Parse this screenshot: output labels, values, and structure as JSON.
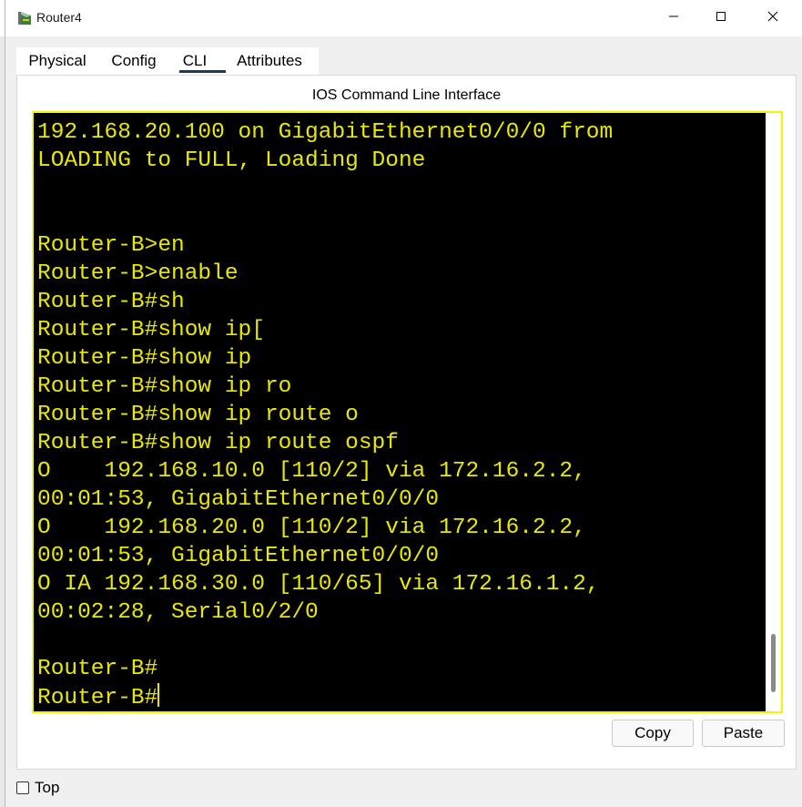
{
  "window": {
    "title": "Router4",
    "icon": "router-icon",
    "controls": [
      "minimize-icon",
      "maximize-icon",
      "close-icon"
    ]
  },
  "tabs": [
    {
      "label": "Physical"
    },
    {
      "label": "Config"
    },
    {
      "label": "CLI",
      "active": true
    },
    {
      "label": "Attributes"
    }
  ],
  "cli": {
    "title": "IOS Command Line Interface",
    "colors": {
      "background": "#000000",
      "text": "#e8e800",
      "border": "#f5f500"
    },
    "lines": [
      "192.168.20.100 on GigabitEthernet0/0/0 from",
      "LOADING to FULL, Loading Done",
      "",
      "",
      "Router-B>en",
      "Router-B>enable",
      "Router-B#sh",
      "Router-B#show ip[",
      "Router-B#show ip",
      "Router-B#show ip ro",
      "Router-B#show ip route o",
      "Router-B#show ip route ospf",
      "O    192.168.10.0 [110/2] via 172.16.2.2,",
      "00:01:53, GigabitEthernet0/0/0",
      "O    192.168.20.0 [110/2] via 172.16.2.2,",
      "00:01:53, GigabitEthernet0/0/0",
      "O IA 192.168.30.0 [110/65] via 172.16.1.2,",
      "00:02:28, Serial0/2/0",
      "",
      "Router-B#",
      "Router-B#"
    ]
  },
  "buttons": {
    "copy": "Copy",
    "paste": "Paste"
  },
  "top_checkbox": {
    "label": "Top",
    "checked": false
  }
}
